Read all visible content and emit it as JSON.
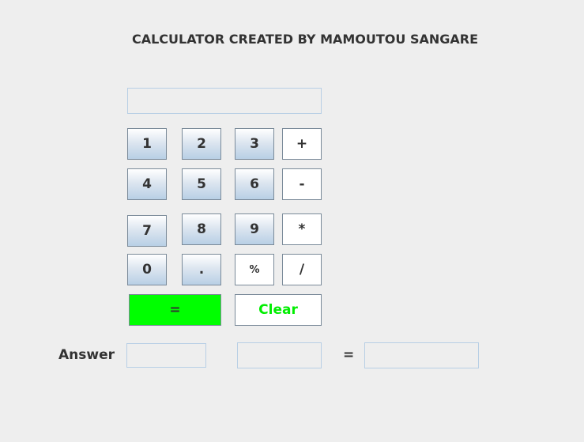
{
  "title": "CALCULATOR CREATED BY MAMOUTOU SANGARE",
  "display": {
    "value": ""
  },
  "buttons": {
    "b1": "1",
    "b2": "2",
    "b3": "3",
    "plus": "+",
    "b4": "4",
    "b5": "5",
    "b6": "6",
    "minus": "-",
    "b7": "7",
    "b8": "8",
    "b9": "9",
    "multiply": "*",
    "b0": "0",
    "dot": ".",
    "percent": "%",
    "divide": "/",
    "equals": "=",
    "clear": "Clear"
  },
  "answer": {
    "label": "Answer",
    "operand1": "",
    "operand2": "",
    "equals_sign": "=",
    "result": ""
  },
  "colors": {
    "equals_bg": "#00ff00",
    "clear_text": "#00ee00",
    "field_border": "#b8cfe5"
  }
}
